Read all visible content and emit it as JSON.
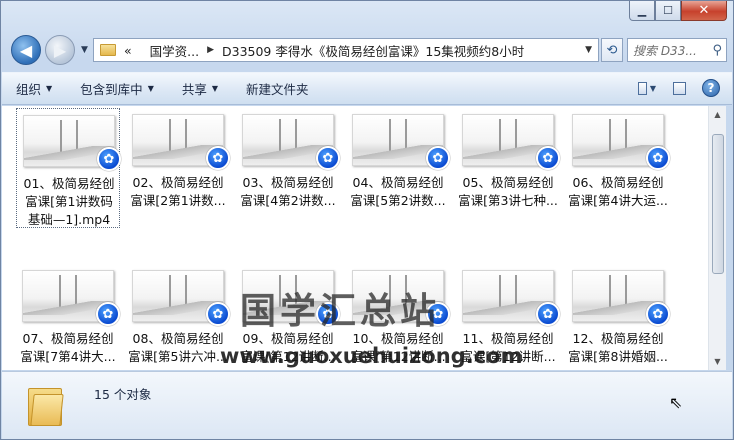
{
  "window": {
    "minimize": "▁",
    "maximize": "☐",
    "close": "✕"
  },
  "nav": {
    "path_root": "«",
    "crumb1": "国学资...",
    "crumb_sep": "▶",
    "crumb2": "D33509 李得水《极简易经创富课》15集视频约8小时",
    "search_placeholder": "搜索 D33..."
  },
  "toolbar": {
    "organize": "组织",
    "include_library": "包含到库中",
    "share": "共享",
    "new_folder": "新建文件夹"
  },
  "files": [
    {
      "name": "01、极简易经创富课[第1讲数码基础—1].mp4",
      "line1": "01、极简易经创",
      "line2": "富课[第1讲数码",
      "line3": "基础—1].mp4"
    },
    {
      "name": "02、极简易经创富课[2第1讲数...",
      "line1": "02、极简易经创",
      "line2": "富课[2第1讲数..."
    },
    {
      "name": "03、极简易经创富课[4第2讲数...",
      "line1": "03、极简易经创",
      "line2": "富课[4第2讲数..."
    },
    {
      "name": "04、极简易经创富课[5第2讲数...",
      "line1": "04、极简易经创",
      "line2": "富课[5第2讲数..."
    },
    {
      "name": "05、极简易经创富课[第3讲七种...",
      "line1": "05、极简易经创",
      "line2": "富课[第3讲七种..."
    },
    {
      "name": "06、极简易经创富课[第4讲大运...",
      "line1": "06、极简易经创",
      "line2": "富课[第4讲大运..."
    },
    {
      "name": "07、极简易经创富课[7第4讲大...",
      "line1": "07、极简易经创",
      "line2": "富课[7第4讲大..."
    },
    {
      "name": "08、极简易经创富课[第5讲六冲...",
      "line1": "08、极简易经创",
      "line2": "富课[第5讲六冲..."
    },
    {
      "name": "09、极简易经创富课[第12讲断...",
      "line1": "09、极简易经创",
      "line2": "富课[第12讲断..."
    },
    {
      "name": "10、极简易经创富课[第12讲断...",
      "line1": "10、极简易经创",
      "line2": "富课[第12讲断..."
    },
    {
      "name": "11、极简易经创富课[第12讲断...",
      "line1": "11、极简易经创",
      "line2": "富课[第12讲断..."
    },
    {
      "name": "12、极简易经创富课[第8讲婚姻...",
      "line1": "12、极简易经创",
      "line2": "富课[第8讲婚姻..."
    }
  ],
  "watermark": {
    "cn": "国学汇总站",
    "url": "www.guoxuehuizong.com"
  },
  "details": {
    "count": "15 个对象"
  },
  "icons": {
    "back": "back-arrow-icon",
    "forward": "forward-arrow-icon",
    "refresh": "refresh-icon",
    "search": "search-icon",
    "help": "help-icon",
    "file_badge": "video-player-icon"
  },
  "colors": {
    "accent": "#2f6fb8",
    "badge": "#0b4bd1",
    "close": "#c7412c"
  }
}
